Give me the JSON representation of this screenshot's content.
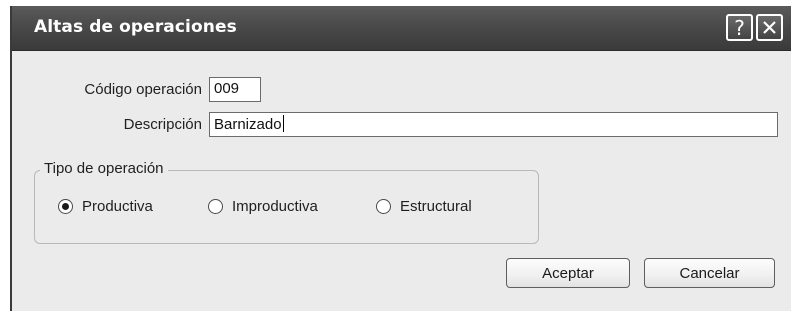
{
  "window": {
    "title": "Altas de operaciones",
    "help_glyph": "?",
    "title_bar_color": "#4a4a4a"
  },
  "form": {
    "codigo": {
      "label": "Código operación",
      "value": "009"
    },
    "descripcion": {
      "label": "Descripción",
      "value": "Barnizado"
    }
  },
  "tipo_operacion": {
    "legend": "Tipo de operación",
    "options": [
      {
        "label": "Productiva",
        "selected": true
      },
      {
        "label": "Improductiva",
        "selected": false
      },
      {
        "label": "Estructural",
        "selected": false
      }
    ]
  },
  "buttons": {
    "accept_label": "Aceptar",
    "cancel_label": "Cancelar"
  },
  "icons": {
    "help": "help-icon",
    "close": "close-icon"
  }
}
